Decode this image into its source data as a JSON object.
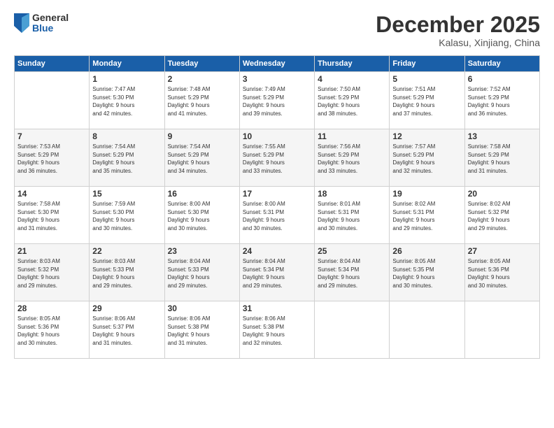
{
  "header": {
    "logo_general": "General",
    "logo_blue": "Blue",
    "month_title": "December 2025",
    "location": "Kalasu, Xinjiang, China"
  },
  "days_of_week": [
    "Sunday",
    "Monday",
    "Tuesday",
    "Wednesday",
    "Thursday",
    "Friday",
    "Saturday"
  ],
  "weeks": [
    [
      {
        "day": "",
        "sunrise": "",
        "sunset": "",
        "daylight": ""
      },
      {
        "day": "1",
        "sunrise": "Sunrise: 7:47 AM",
        "sunset": "Sunset: 5:30 PM",
        "daylight": "Daylight: 9 hours and 42 minutes."
      },
      {
        "day": "2",
        "sunrise": "Sunrise: 7:48 AM",
        "sunset": "Sunset: 5:29 PM",
        "daylight": "Daylight: 9 hours and 41 minutes."
      },
      {
        "day": "3",
        "sunrise": "Sunrise: 7:49 AM",
        "sunset": "Sunset: 5:29 PM",
        "daylight": "Daylight: 9 hours and 39 minutes."
      },
      {
        "day": "4",
        "sunrise": "Sunrise: 7:50 AM",
        "sunset": "Sunset: 5:29 PM",
        "daylight": "Daylight: 9 hours and 38 minutes."
      },
      {
        "day": "5",
        "sunrise": "Sunrise: 7:51 AM",
        "sunset": "Sunset: 5:29 PM",
        "daylight": "Daylight: 9 hours and 37 minutes."
      },
      {
        "day": "6",
        "sunrise": "Sunrise: 7:52 AM",
        "sunset": "Sunset: 5:29 PM",
        "daylight": "Daylight: 9 hours and 36 minutes."
      }
    ],
    [
      {
        "day": "7",
        "sunrise": "Sunrise: 7:53 AM",
        "sunset": "Sunset: 5:29 PM",
        "daylight": "Daylight: 9 hours and 36 minutes."
      },
      {
        "day": "8",
        "sunrise": "Sunrise: 7:54 AM",
        "sunset": "Sunset: 5:29 PM",
        "daylight": "Daylight: 9 hours and 35 minutes."
      },
      {
        "day": "9",
        "sunrise": "Sunrise: 7:54 AM",
        "sunset": "Sunset: 5:29 PM",
        "daylight": "Daylight: 9 hours and 34 minutes."
      },
      {
        "day": "10",
        "sunrise": "Sunrise: 7:55 AM",
        "sunset": "Sunset: 5:29 PM",
        "daylight": "Daylight: 9 hours and 33 minutes."
      },
      {
        "day": "11",
        "sunrise": "Sunrise: 7:56 AM",
        "sunset": "Sunset: 5:29 PM",
        "daylight": "Daylight: 9 hours and 33 minutes."
      },
      {
        "day": "12",
        "sunrise": "Sunrise: 7:57 AM",
        "sunset": "Sunset: 5:29 PM",
        "daylight": "Daylight: 9 hours and 32 minutes."
      },
      {
        "day": "13",
        "sunrise": "Sunrise: 7:58 AM",
        "sunset": "Sunset: 5:29 PM",
        "daylight": "Daylight: 9 hours and 31 minutes."
      }
    ],
    [
      {
        "day": "14",
        "sunrise": "Sunrise: 7:58 AM",
        "sunset": "Sunset: 5:30 PM",
        "daylight": "Daylight: 9 hours and 31 minutes."
      },
      {
        "day": "15",
        "sunrise": "Sunrise: 7:59 AM",
        "sunset": "Sunset: 5:30 PM",
        "daylight": "Daylight: 9 hours and 30 minutes."
      },
      {
        "day": "16",
        "sunrise": "Sunrise: 8:00 AM",
        "sunset": "Sunset: 5:30 PM",
        "daylight": "Daylight: 9 hours and 30 minutes."
      },
      {
        "day": "17",
        "sunrise": "Sunrise: 8:00 AM",
        "sunset": "Sunset: 5:31 PM",
        "daylight": "Daylight: 9 hours and 30 minutes."
      },
      {
        "day": "18",
        "sunrise": "Sunrise: 8:01 AM",
        "sunset": "Sunset: 5:31 PM",
        "daylight": "Daylight: 9 hours and 30 minutes."
      },
      {
        "day": "19",
        "sunrise": "Sunrise: 8:02 AM",
        "sunset": "Sunset: 5:31 PM",
        "daylight": "Daylight: 9 hours and 29 minutes."
      },
      {
        "day": "20",
        "sunrise": "Sunrise: 8:02 AM",
        "sunset": "Sunset: 5:32 PM",
        "daylight": "Daylight: 9 hours and 29 minutes."
      }
    ],
    [
      {
        "day": "21",
        "sunrise": "Sunrise: 8:03 AM",
        "sunset": "Sunset: 5:32 PM",
        "daylight": "Daylight: 9 hours and 29 minutes."
      },
      {
        "day": "22",
        "sunrise": "Sunrise: 8:03 AM",
        "sunset": "Sunset: 5:33 PM",
        "daylight": "Daylight: 9 hours and 29 minutes."
      },
      {
        "day": "23",
        "sunrise": "Sunrise: 8:04 AM",
        "sunset": "Sunset: 5:33 PM",
        "daylight": "Daylight: 9 hours and 29 minutes."
      },
      {
        "day": "24",
        "sunrise": "Sunrise: 8:04 AM",
        "sunset": "Sunset: 5:34 PM",
        "daylight": "Daylight: 9 hours and 29 minutes."
      },
      {
        "day": "25",
        "sunrise": "Sunrise: 8:04 AM",
        "sunset": "Sunset: 5:34 PM",
        "daylight": "Daylight: 9 hours and 29 minutes."
      },
      {
        "day": "26",
        "sunrise": "Sunrise: 8:05 AM",
        "sunset": "Sunset: 5:35 PM",
        "daylight": "Daylight: 9 hours and 30 minutes."
      },
      {
        "day": "27",
        "sunrise": "Sunrise: 8:05 AM",
        "sunset": "Sunset: 5:36 PM",
        "daylight": "Daylight: 9 hours and 30 minutes."
      }
    ],
    [
      {
        "day": "28",
        "sunrise": "Sunrise: 8:05 AM",
        "sunset": "Sunset: 5:36 PM",
        "daylight": "Daylight: 9 hours and 30 minutes."
      },
      {
        "day": "29",
        "sunrise": "Sunrise: 8:06 AM",
        "sunset": "Sunset: 5:37 PM",
        "daylight": "Daylight: 9 hours and 31 minutes."
      },
      {
        "day": "30",
        "sunrise": "Sunrise: 8:06 AM",
        "sunset": "Sunset: 5:38 PM",
        "daylight": "Daylight: 9 hours and 31 minutes."
      },
      {
        "day": "31",
        "sunrise": "Sunrise: 8:06 AM",
        "sunset": "Sunset: 5:38 PM",
        "daylight": "Daylight: 9 hours and 32 minutes."
      },
      {
        "day": "",
        "sunrise": "",
        "sunset": "",
        "daylight": ""
      },
      {
        "day": "",
        "sunrise": "",
        "sunset": "",
        "daylight": ""
      },
      {
        "day": "",
        "sunrise": "",
        "sunset": "",
        "daylight": ""
      }
    ]
  ]
}
